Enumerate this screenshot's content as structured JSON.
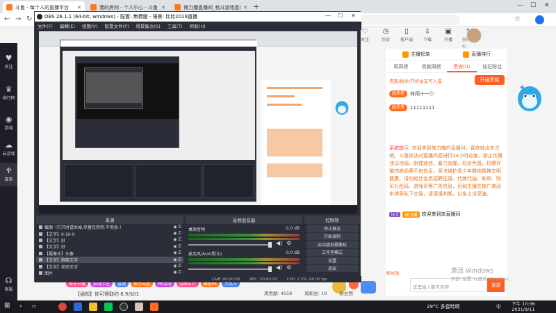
{
  "browser": {
    "tabs": [
      {
        "label": "斗鱼 - 每个人的直播平台"
      },
      {
        "label": "我的房间 - 个人中心 - 斗鱼"
      },
      {
        "label": "保力播直播间_格斗游戏直播_斗鱼"
      }
    ],
    "new_tab": "+",
    "window_controls": [
      "—",
      "☐",
      "✕"
    ]
  },
  "obs": {
    "title": "OBS 26.1.1 (64-bit, windows) - 配置: 無標題 - 場景: 比比2019直播",
    "menu": [
      "文件(F)",
      "編輯(E)",
      "视图(V)",
      "配置文件(P)",
      "場景集合(S)",
      "工具(T)",
      "帮助(H)"
    ],
    "docks": {
      "sources_title": "来源",
      "mixer_title": "音频混音器",
      "controls_title": "控制项"
    },
    "sources": [
      {
        "label": "截图（打开时请关掉,尽量仅禁用:不用会-）",
        "selected": false
      },
      {
        "label": "【文字】0-10-0",
        "selected": false
      },
      {
        "label": "【文字】好",
        "selected": false
      },
      {
        "label": "【文字】好",
        "selected": false
      },
      {
        "label": "【摄像头】头像",
        "selected": false
      },
      {
        "label": "【文字】限期文字",
        "selected": true
      },
      {
        "label": "【文字】老师文字",
        "selected": false
      },
      {
        "label": "图片",
        "selected": false
      }
    ],
    "mixer": [
      {
        "label": "桌面音频",
        "db": "0.0 dB"
      },
      {
        "label": "麦克风/Aux(默认)",
        "db": "0.0 dB"
      }
    ],
    "controls": [
      "停止推流",
      "开始录制",
      "启动虚拟摄像机",
      "工作室模式",
      "设置",
      "退出"
    ],
    "status": {
      "live": "LIVE: 00:00:00",
      "rec": "REC: 00:00:00",
      "cpu": "CPU: 2.3%, 60.00 fps"
    }
  },
  "sidebar": {
    "items": [
      {
        "label": "关注",
        "icon": "heart-icon"
      },
      {
        "label": "排行榜",
        "icon": "trophy-icon"
      },
      {
        "label": "游戏",
        "icon": "gamepad-icon"
      },
      {
        "label": "云游戏",
        "icon": "cloud-icon"
      },
      {
        "label": "赛事",
        "icon": "cup-icon"
      },
      {
        "label": "客服",
        "icon": "headset-icon"
      }
    ]
  },
  "topnav": [
    {
      "label": "关注",
      "icon": "heart-icon"
    },
    {
      "label": "历史",
      "icon": "clock-icon"
    },
    {
      "label": "客户端",
      "icon": "phone-icon"
    },
    {
      "label": "下载",
      "icon": "download-icon"
    },
    {
      "label": "开播",
      "icon": "camera-icon"
    },
    {
      "label": "创作中心",
      "icon": "creator-icon"
    }
  ],
  "room": {
    "rank_header": [
      "主播榜单",
      "直播排行"
    ],
    "rank_tabs": [
      "周周榜",
      "贡献周榜",
      "贵宾(0)",
      "钻石粉丝"
    ],
    "welcome": "贵族/粉丝/守护水友可入座",
    "open_button": "开通贵族",
    "chat": [
      {
        "badge": "超星星",
        "text": "休闲十一少"
      },
      {
        "badge": "超星星",
        "text": "11111111"
      }
    ],
    "system_label": "系统提示:",
    "system_text": "欢迎来到保力播的直播间。喜欢就点关注吧。斗鱼依法对直播内容进行24小时巡查，禁止传播违法违规、封建迷信、暴力血腥、低俗色情、招嫖诈骗违禁品等不良信息，坚决维护青少年群体精神文明健康。请勿轻信各类招聘征婚、代练代抽、刷单、购买礼包码、游戏币等广告信息，且如主播在推广商品中诱导私下交易，请谨慎判断，以免上当受骗。",
    "welcome_user": {
      "lv1": "lv.5",
      "lv2": "保力播",
      "text": "欢迎来到本直播间"
    },
    "input_placeholder": "这里输入聊天内容",
    "send": "发送",
    "fans_row": "粉丝团",
    "activate_line1": "激活 Windows",
    "activate_line2": "转到\"设置\"以激活 Windows。"
  },
  "gifts": [
    "娱乐开播",
    "狂战士巴",
    "喜猪",
    "鼎力天团",
    "PK活动",
    "包纳车行",
    "鞭炮PK",
    "大乱斗"
  ],
  "stats": [
    "周贡献: 4558",
    "周粉丝: 19",
    "粉丝团"
  ],
  "taskbar": {
    "notification": "【通知】你可得取约 8.9/$01",
    "weather": "29°C 多雲時晴",
    "lang": "中",
    "time": "下午 10:36",
    "date": "2021/9/11"
  }
}
